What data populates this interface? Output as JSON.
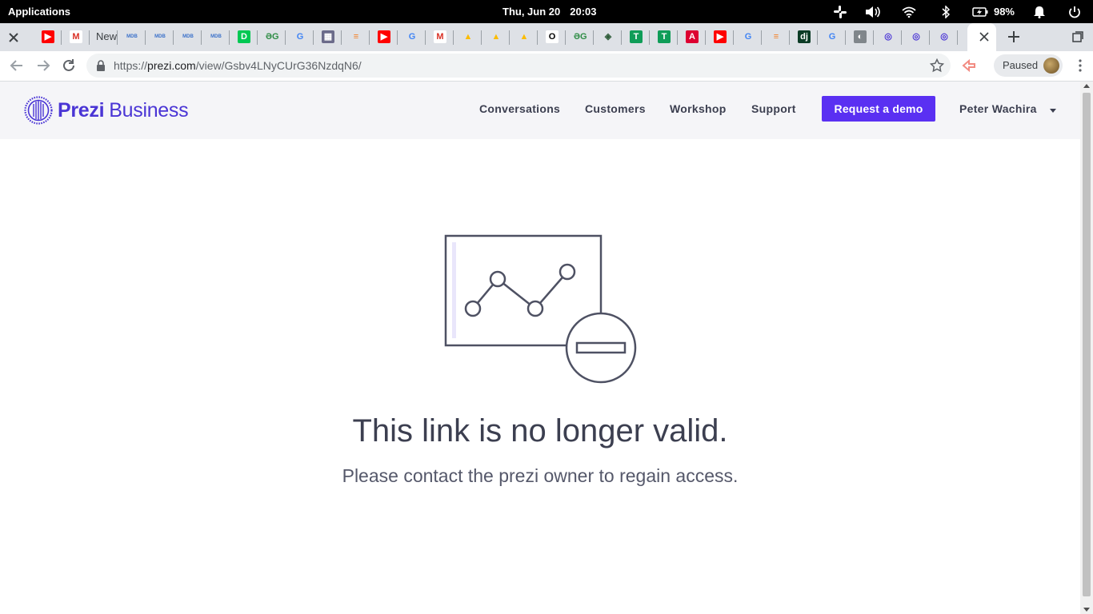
{
  "os": {
    "apps_label": "Applications",
    "date": "Thu, Jun 20",
    "time": "20:03",
    "battery": "98%"
  },
  "tabs": {
    "partial_title": "New",
    "favicons": [
      "youtube",
      "gmail",
      "new",
      "mdb",
      "mdb",
      "mdb",
      "mdb",
      "deno",
      "geeksforgeeks",
      "google",
      "adobe",
      "stackoverflow",
      "youtube",
      "google",
      "gmail",
      "drive",
      "drive",
      "drive",
      "notion",
      "geeksforgeeks",
      "sourcegraph",
      "sheets",
      "sheets",
      "angular",
      "youtube",
      "google",
      "stackoverflow",
      "django",
      "google",
      "globe",
      "prezi",
      "prezi",
      "prezi"
    ]
  },
  "toolbar": {
    "url_scheme": "https://",
    "url_host": "prezi.com",
    "url_path": "/view/Gsbv4LNyCUrG36NzdqN6/",
    "profile_label": "Paused"
  },
  "site": {
    "brand_bold": "Prezi",
    "brand_rest": "Business",
    "nav": [
      "Conversations",
      "Customers",
      "Workshop",
      "Support"
    ],
    "cta": "Request a demo",
    "user_name": "Peter Wachira",
    "accent_color": "#5a30f2"
  },
  "message": {
    "headline": "This link is no longer valid.",
    "subline": "Please contact the prezi owner to regain access."
  }
}
